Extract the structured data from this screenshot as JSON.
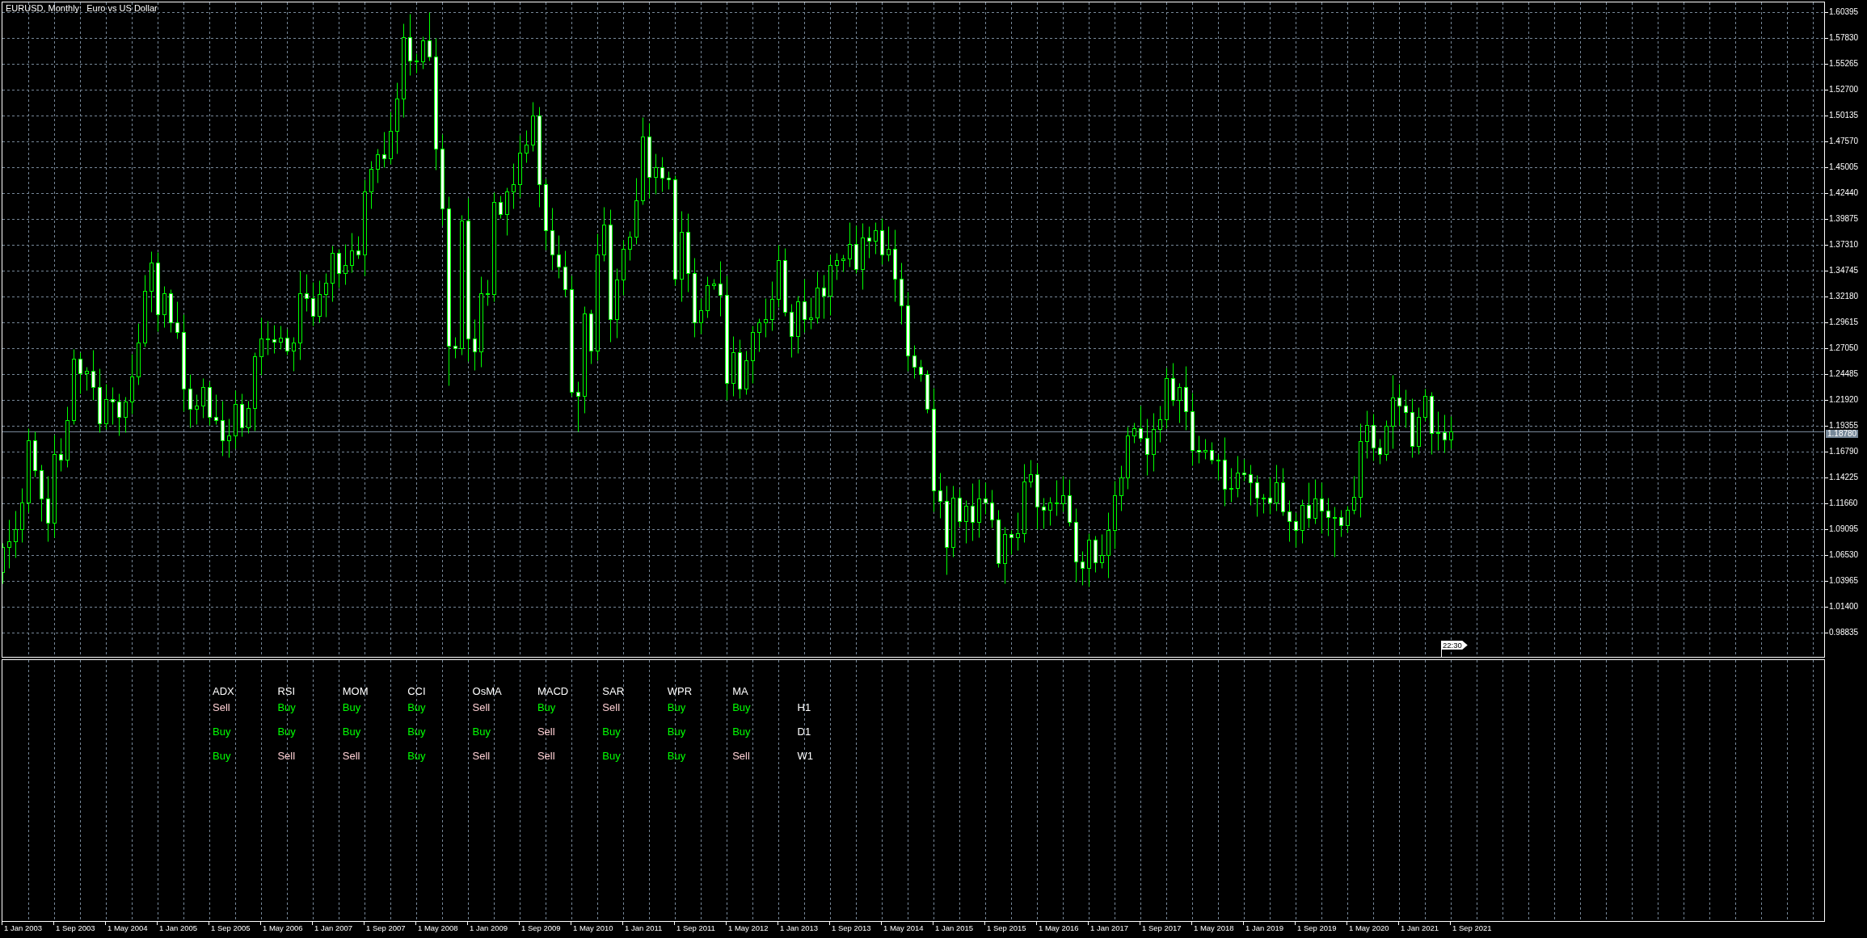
{
  "chart_window": {
    "title": "EURUSD, Monthly:  Euro vs US Dollar",
    "time_marker": "22:30",
    "current_price": "1.18780"
  },
  "price_axis": {
    "labels": [
      "1.60395",
      "1.57830",
      "1.55265",
      "1.52700",
      "1.50135",
      "1.47570",
      "1.45005",
      "1.42440",
      "1.39875",
      "1.37310",
      "1.34745",
      "1.32180",
      "1.29615",
      "1.27050",
      "1.24485",
      "1.21920",
      "1.19355",
      "1.16790",
      "1.14225",
      "1.11660",
      "1.09095",
      "1.06530",
      "1.03965",
      "1.01400",
      "0.98835"
    ]
  },
  "signals_panel": {
    "columns": [
      "ADX",
      "RSI",
      "MOM",
      "CCI",
      "OsMA",
      "MACD",
      "SAR",
      "WPR",
      "MA"
    ],
    "rows": [
      {
        "timeframe": "H1",
        "cells": [
          {
            "text": "Sell",
            "color": "#ffd0d4"
          },
          {
            "text": "Buy",
            "color": "#00ff00"
          },
          {
            "text": "Buy",
            "color": "#00ff00"
          },
          {
            "text": "Buy",
            "color": "#00ff00"
          },
          {
            "text": "Sell",
            "color": "#ffd0d4"
          },
          {
            "text": "Buy",
            "color": "#00ff00"
          },
          {
            "text": "Sell",
            "color": "#ffd0d4"
          },
          {
            "text": "Buy",
            "color": "#00ff00"
          },
          {
            "text": "Buy",
            "color": "#00ff00"
          }
        ]
      },
      {
        "timeframe": "D1",
        "cells": [
          {
            "text": "Buy",
            "color": "#00ff00"
          },
          {
            "text": "Buy",
            "color": "#00ff00"
          },
          {
            "text": "Buy",
            "color": "#00ff00"
          },
          {
            "text": "Buy",
            "color": "#00ff00"
          },
          {
            "text": "Buy",
            "color": "#00ff00"
          },
          {
            "text": "Sell",
            "color": "#ffd0d4"
          },
          {
            "text": "Buy",
            "color": "#00ff00"
          },
          {
            "text": "Buy",
            "color": "#00ff00"
          },
          {
            "text": "Buy",
            "color": "#00ff00"
          }
        ]
      },
      {
        "timeframe": "W1",
        "cells": [
          {
            "text": "Buy",
            "color": "#00ff00"
          },
          {
            "text": "Sell",
            "color": "#ffd0d4"
          },
          {
            "text": "Sell",
            "color": "#ffd0d4"
          },
          {
            "text": "Buy",
            "color": "#00ff00"
          },
          {
            "text": "Sell",
            "color": "#ffd0d4"
          },
          {
            "text": "Sell",
            "color": "#ffd0d4"
          },
          {
            "text": "Buy",
            "color": "#00ff00"
          },
          {
            "text": "Buy",
            "color": "#00ff00"
          },
          {
            "text": "Sell",
            "color": "#ffd0d4"
          }
        ]
      }
    ]
  },
  "time_axis": {
    "labels": [
      "1 Jan 2003",
      "1 Sep 2003",
      "1 May 2004",
      "1 Jan 2005",
      "1 Sep 2005",
      "1 May 2006",
      "1 Jan 2007",
      "1 Sep 2007",
      "1 May 2008",
      "1 Jan 2009",
      "1 Sep 2009",
      "1 May 2010",
      "1 Jan 2011",
      "1 Sep 2011",
      "1 May 2012",
      "1 Jan 2013",
      "1 Sep 2013",
      "1 May 2014",
      "1 Jan 2015",
      "1 Sep 2015",
      "1 May 2016",
      "1 Jan 2017",
      "1 Sep 2017",
      "1 May 2018",
      "1 Jan 2019",
      "1 Sep 2019",
      "1 May 2020",
      "1 Jan 2021",
      "1 Sep 2021"
    ]
  }
}
